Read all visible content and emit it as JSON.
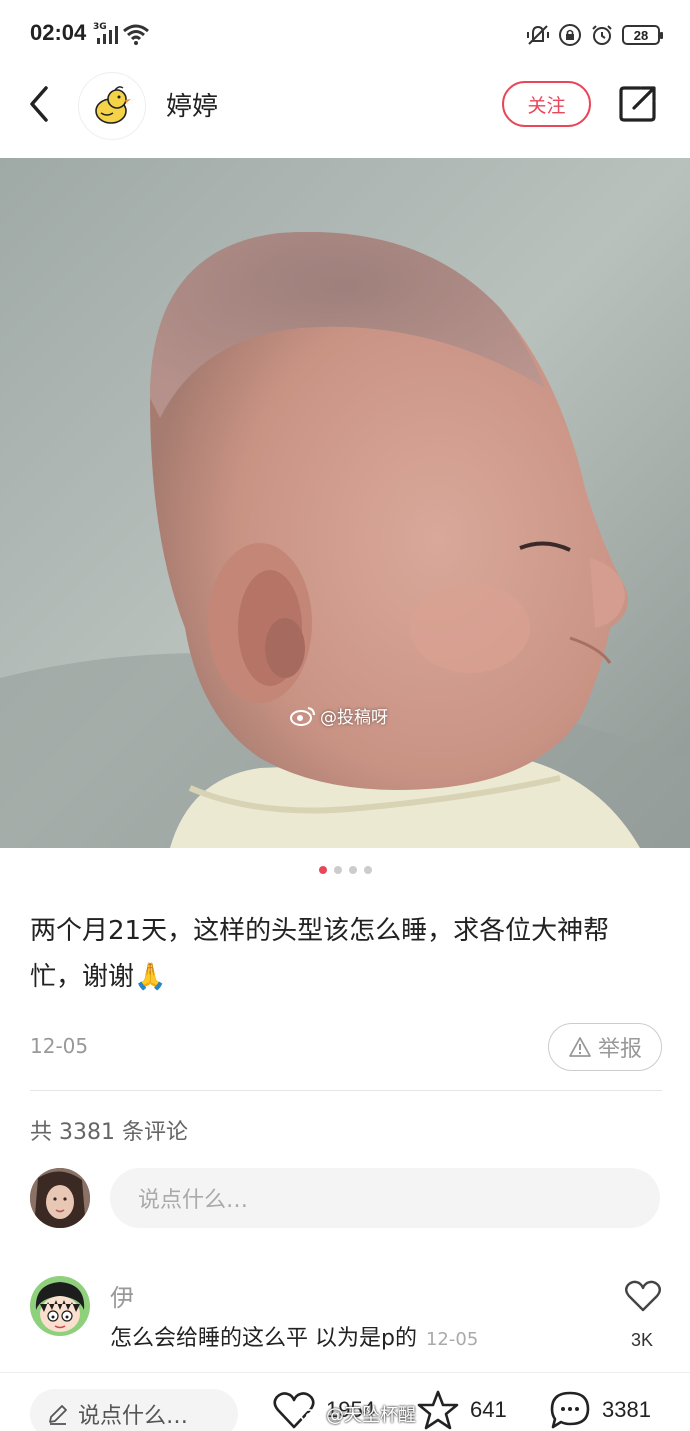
{
  "status": {
    "time": "02:04",
    "network": "3G",
    "battery": "28"
  },
  "header": {
    "author_name": "婷婷",
    "follow_label": "关注"
  },
  "photo": {
    "watermark": "@投稿呀",
    "page_count": 4,
    "active_page": 1
  },
  "post": {
    "text": "两个月21天，这样的头型该怎么睡，求各位大神帮忙，谢谢",
    "emoji": "🙏",
    "date": "12-05",
    "report_label": "举报"
  },
  "comments": {
    "count_text": "共 3381 条评论",
    "input_placeholder": "说点什么…",
    "items": [
      {
        "name": "伊",
        "text": "怎么会给睡的这么平 以为是p的",
        "date": "12-05",
        "likes": "3K"
      }
    ]
  },
  "bottom_bar": {
    "input_placeholder": "说点什么…",
    "likes": "1954",
    "stars": "641",
    "comments": "3381",
    "watermark": "@天坠杯醒"
  },
  "colors": {
    "accent": "#e8475a",
    "muted": "#999999",
    "input_bg": "#f4f4f4"
  },
  "icons": [
    "back-icon",
    "duck-avatar-icon",
    "share-icon",
    "warning-icon",
    "heart-icon",
    "star-icon",
    "comment-bubble-icon",
    "pencil-icon"
  ]
}
